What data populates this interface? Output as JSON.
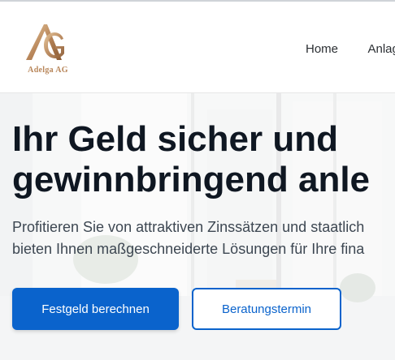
{
  "header": {
    "logo_text": "Adelga AG",
    "nav": [
      "Home",
      "Anlag"
    ]
  },
  "hero": {
    "title_lines": [
      "Ihr Geld sicher und",
      "gewinnbringend anle"
    ],
    "lead_lines": [
      "Profitieren Sie von attraktiven Zinssätzen und staatlich",
      "bieten Ihnen maßgeschneiderte Lösungen für Ihre fina"
    ],
    "primary_button": "Festgeld berechnen",
    "secondary_button": "Beratungstermin"
  },
  "colors": {
    "brand_gold": "#b8865a",
    "accent_blue": "#0a63cc",
    "heading": "#0f1722"
  }
}
